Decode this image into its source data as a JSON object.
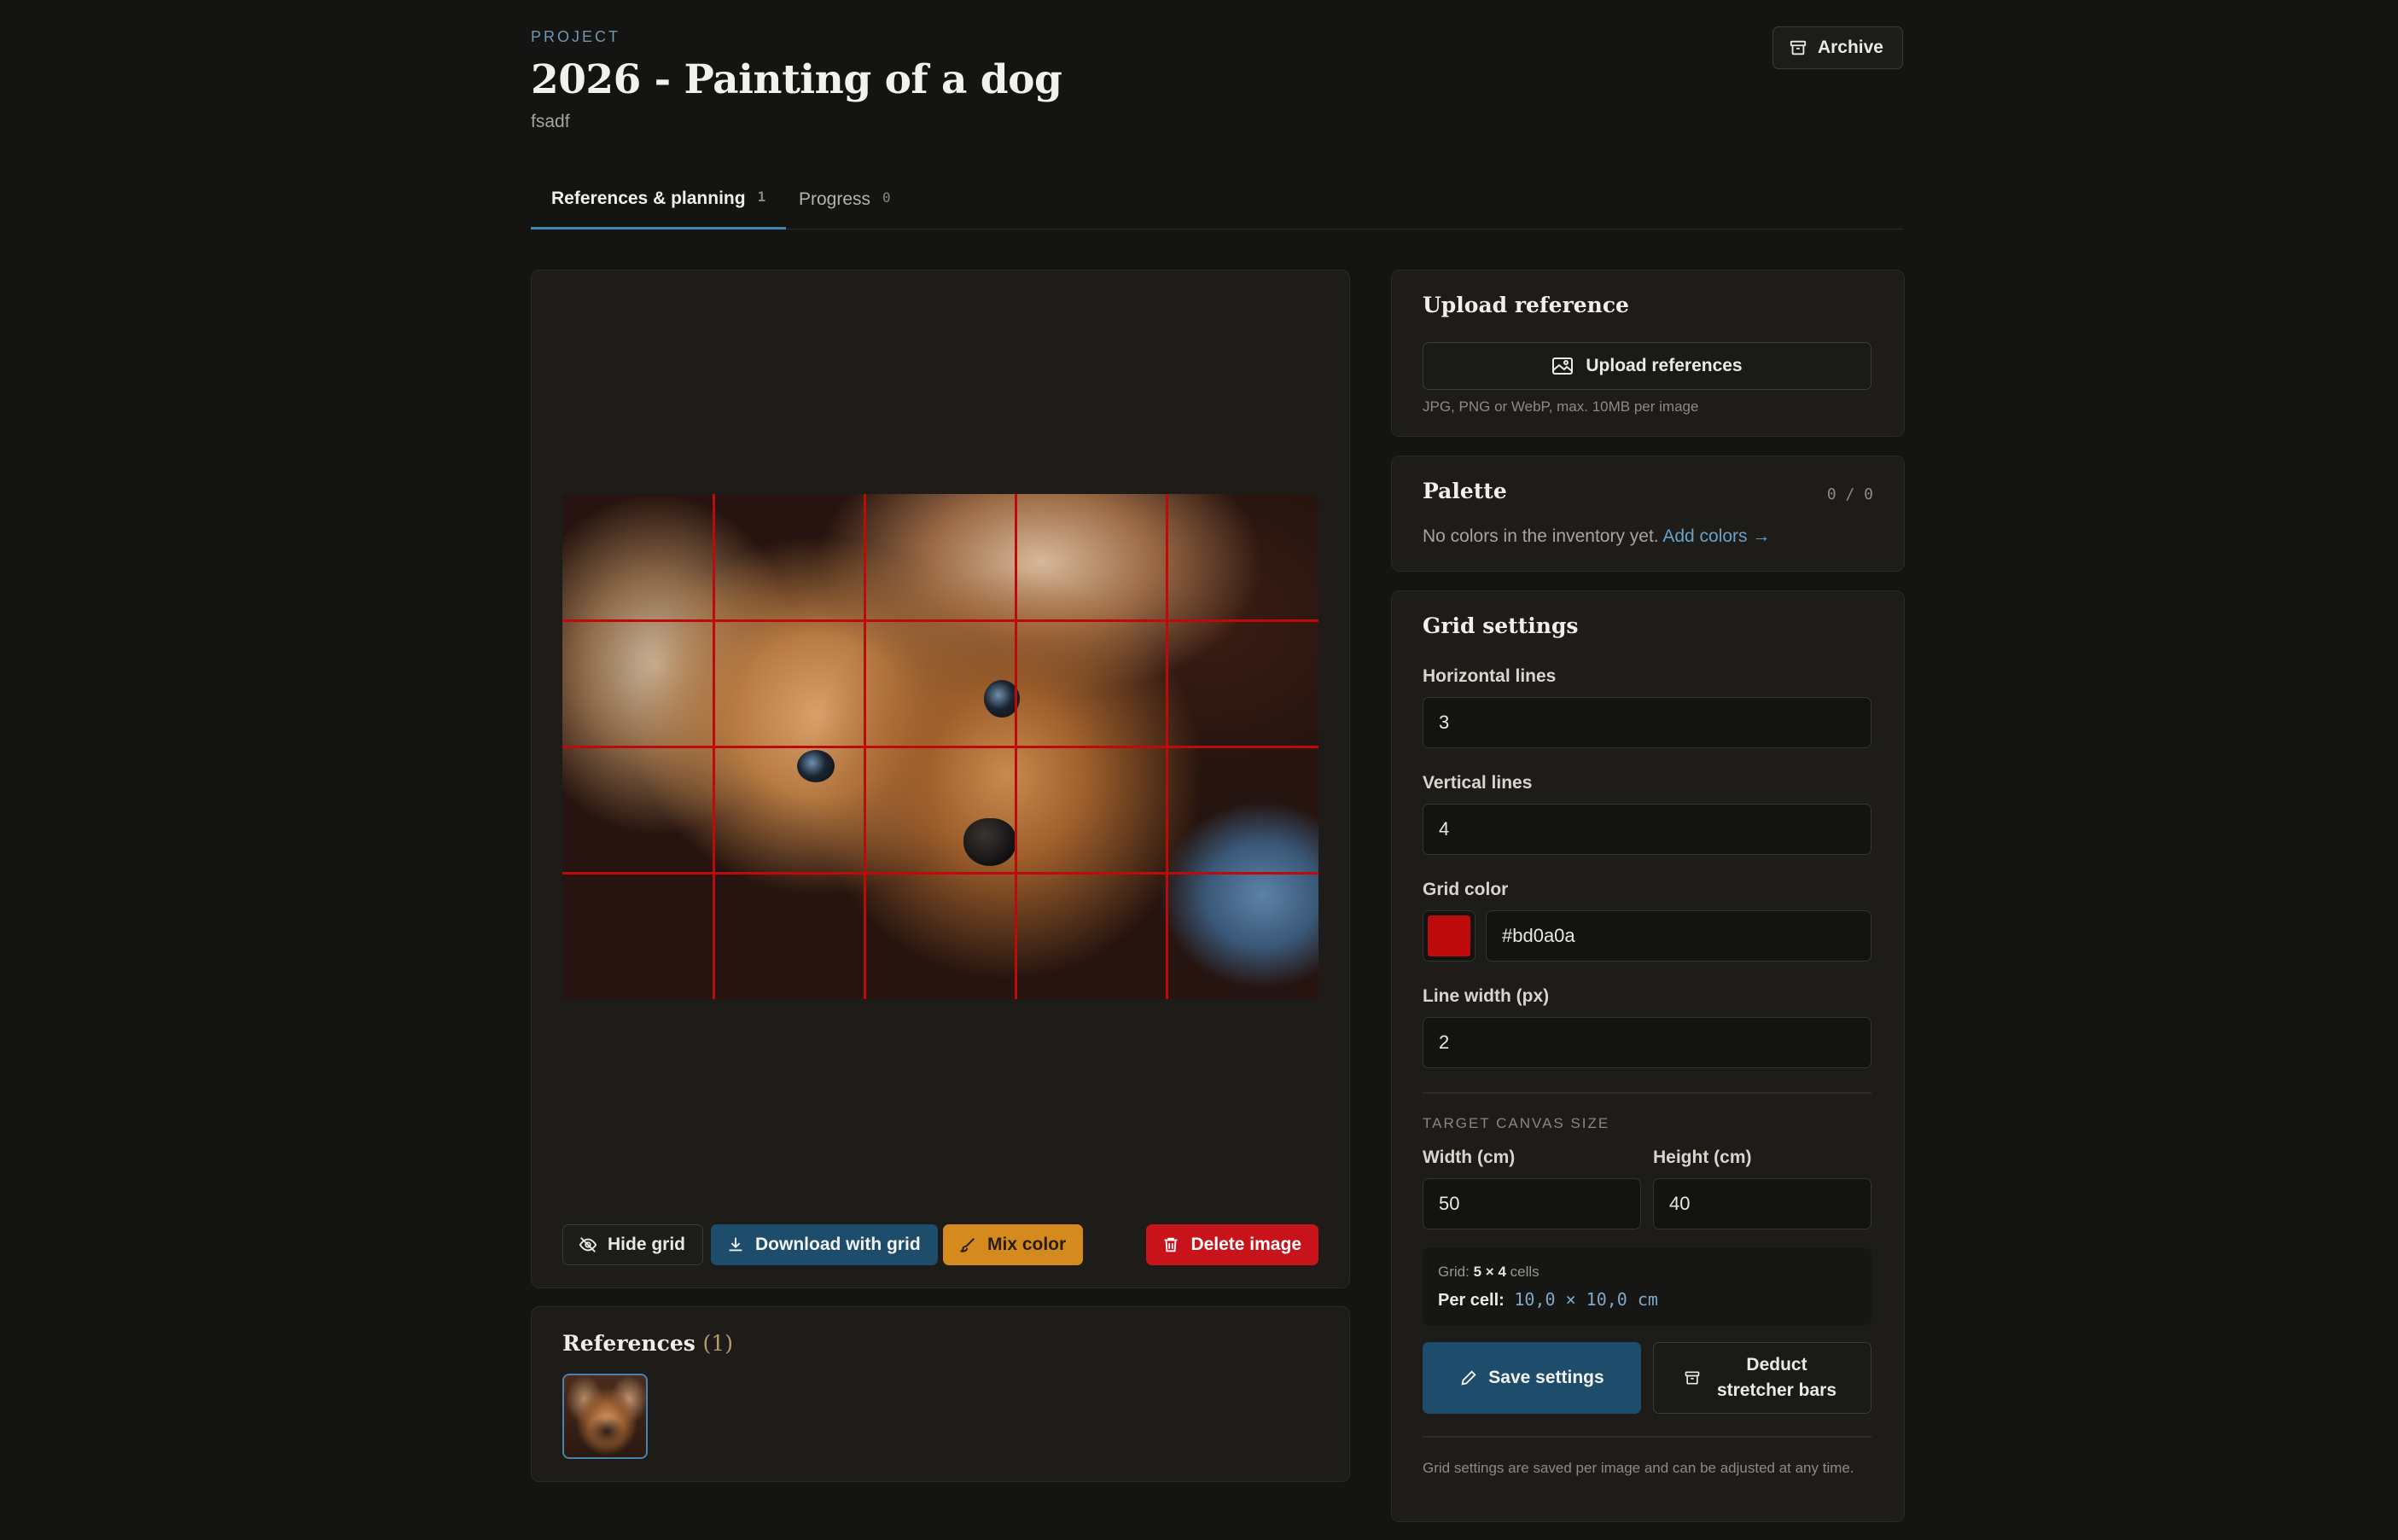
{
  "header": {
    "eyebrow": "PROJECT",
    "title": "2026 - Painting of a dog",
    "subtitle": "fsadf",
    "archive_label": "Archive"
  },
  "tabs": [
    {
      "label": "References & planning",
      "count": "1",
      "active": true
    },
    {
      "label": "Progress",
      "count": "0",
      "active": false
    }
  ],
  "viewer": {
    "image_alt": "Reference photo of a dog with grid overlay",
    "grid_visible": true,
    "actions": {
      "hide_grid": "Hide grid",
      "download": "Download with grid",
      "mix": "Mix color",
      "delete": "Delete image"
    }
  },
  "references": {
    "title": "References",
    "count": "(1)"
  },
  "upload": {
    "title": "Upload reference",
    "button": "Upload references",
    "hint": "JPG, PNG or WebP, max. 10MB per image"
  },
  "palette": {
    "title": "Palette",
    "count": "0 / 0",
    "empty_text": "No colors in the inventory yet.",
    "add_link": "Add colors →"
  },
  "grid_settings": {
    "title": "Grid settings",
    "horizontal_label": "Horizontal lines",
    "horizontal_value": "3",
    "vertical_label": "Vertical lines",
    "vertical_value": "4",
    "color_label": "Grid color",
    "color_value": "#bd0a0a",
    "line_width_label": "Line width (px)",
    "line_width_value": "2",
    "canvas_caption": "TARGET CANVAS SIZE",
    "width_label": "Width (cm)",
    "width_value": "50",
    "height_label": "Height (cm)",
    "height_value": "40",
    "summary_grid_label": "Grid:",
    "summary_cols": "5",
    "summary_times": "×",
    "summary_rows": "4",
    "summary_cells": "cells",
    "summary_per_cell_label": "Per cell:",
    "summary_per_cell_value": "10,0 × 10,0 cm",
    "save_button": "Save settings",
    "deduct_button": "Deduct stretcher bars",
    "footnote": "Grid settings are saved per image and can be adjusted at any time."
  },
  "colors": {
    "accent_blue": "#1d4d6b",
    "mix_orange": "#d48a1c",
    "delete_red": "#c8131b",
    "grid_red": "#bd0a0a",
    "link_blue": "#6aa2c7"
  }
}
